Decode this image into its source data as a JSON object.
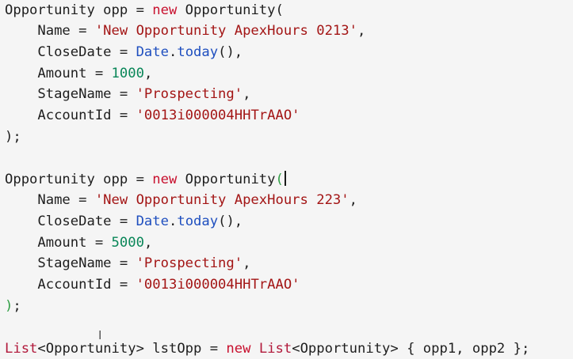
{
  "code": {
    "block1": {
      "decl": "Opportunity opp = ",
      "new_kw": "new",
      "ctor": " Opportunity(",
      "name_key": "    Name = ",
      "name_val": "'New Opportunity ApexHours 0213'",
      "name_end": ",",
      "close_key": "    CloseDate = ",
      "close_date": "Date",
      "close_dot": ".",
      "close_today": "today",
      "close_end": "(),",
      "amount_key": "    Amount = ",
      "amount_val": "1000",
      "amount_end": ",",
      "stage_key": "    StageName = ",
      "stage_val": "'Prospecting'",
      "stage_end": ",",
      "account_key": "    AccountId = ",
      "account_val": "'0013i000004HHTrAAO'",
      "close_paren": ");"
    },
    "block2": {
      "decl": "Opportunity opp = ",
      "new_kw": "new",
      "ctor": " Opportunity",
      "open_paren": "(",
      "name_key": "    Name = ",
      "name_val": "'New Opportunity ApexHours 223'",
      "name_end": ",",
      "close_key": "    CloseDate = ",
      "close_date": "Date",
      "close_dot": ".",
      "close_today": "today",
      "close_end": "(),",
      "amount_key": "    Amount = ",
      "amount_val": "5000",
      "amount_end": ",",
      "stage_key": "    StageName = ",
      "stage_val": "'Prospecting'",
      "stage_end": ",",
      "account_key": "    AccountId = ",
      "account_val": "'0013i000004HHTrAAO'",
      "close_paren": ")",
      "semicolon": ";"
    },
    "list_line": {
      "list_kw": "List",
      "generic1": "<Opportunity> lstOpp = ",
      "new_kw": "new",
      "space": " ",
      "list_kw2": "List",
      "generic2": "<Opportunity> { opp1, opp2 };"
    }
  },
  "cursor_glyph": "I",
  "colors": {
    "background": "#f5f5f5",
    "keyword": "#c8102e",
    "string": "#a31515",
    "number": "#098658",
    "method": "#1f4fbf",
    "bracket_match": "#2f9e44"
  }
}
